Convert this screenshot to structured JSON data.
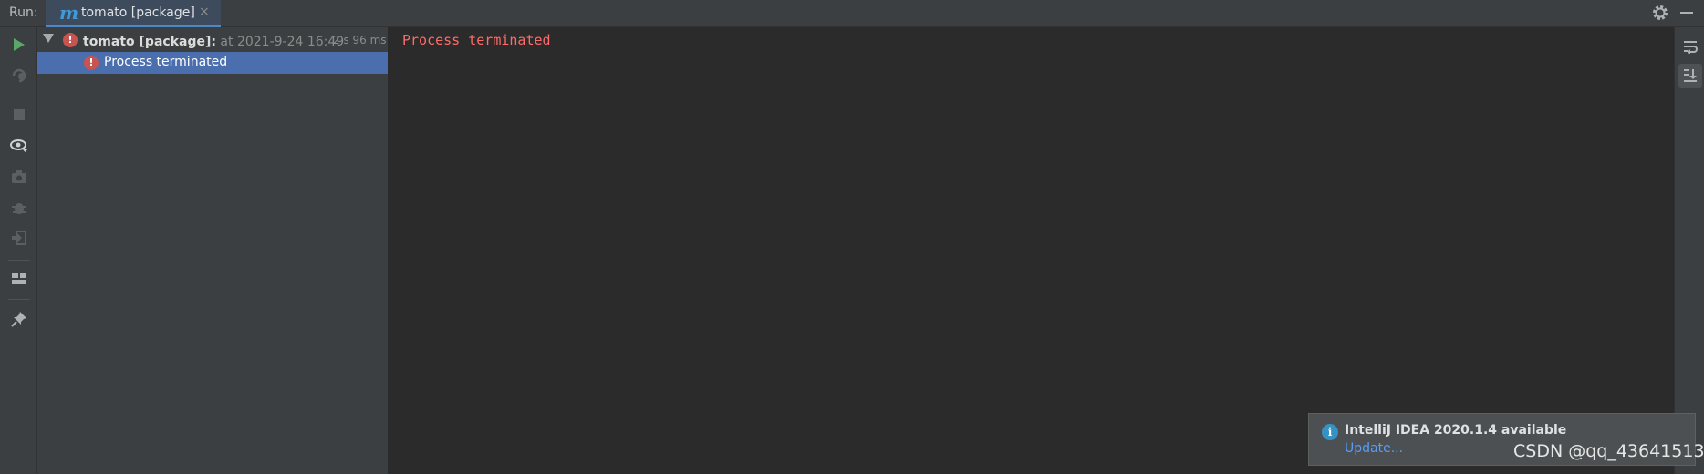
{
  "header": {
    "run_label": "Run:",
    "tab": {
      "icon": "m",
      "label": "tomato [package]",
      "close": "×"
    }
  },
  "tree": {
    "root": {
      "name": "tomato [package]:",
      "info": " at 2021-9-24 16:49",
      "duration": "2 s 96 ms"
    },
    "child": {
      "label": "Process terminated"
    }
  },
  "console": {
    "line": "Process terminated"
  },
  "notification": {
    "title": "IntelliJ IDEA 2020.1.4 available",
    "link": "Update..."
  },
  "watermark": "CSDN @qq_43641513",
  "colors": {
    "error": "#c75450",
    "console_error_text": "#ff6b68",
    "selection": "#4b6eaf",
    "run_green": "#59a869",
    "accent": "#4a88c7"
  },
  "icons": {
    "left_toolbar": [
      "run-icon",
      "rerun-failed-icon",
      "stop-icon",
      "show-passed-icon",
      "dump-threads-icon",
      "debug-icon",
      "exit-icon",
      "layout-icon",
      "pin-icon"
    ],
    "right_toolbar": [
      "soft-wrap-icon",
      "scroll-to-end-icon"
    ],
    "header": [
      "gear-icon",
      "minimize-icon"
    ]
  }
}
